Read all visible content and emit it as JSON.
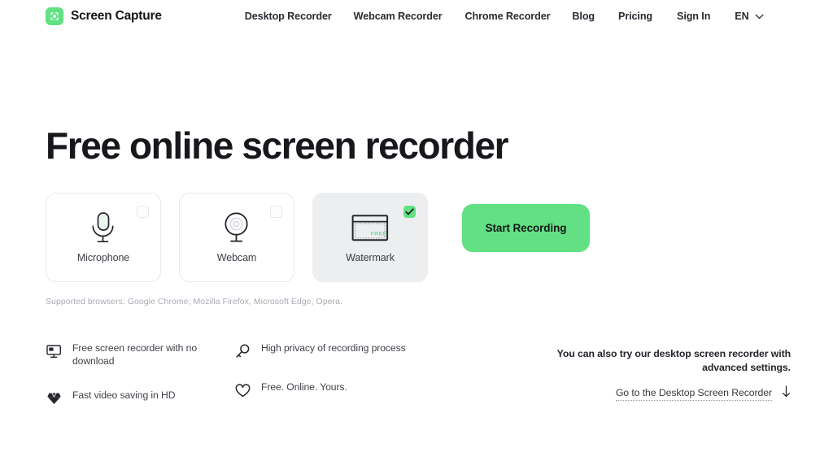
{
  "header": {
    "brand": {
      "name": "Screen Capture",
      "logo_icon": "record-focus-icon",
      "logo_color": "#62E083"
    },
    "nav": [
      {
        "label": "Desktop Recorder",
        "name": "nav-desktop-recorder"
      },
      {
        "label": "Webcam Recorder",
        "name": "nav-webcam-recorder"
      },
      {
        "label": "Chrome Recorder",
        "name": "nav-chrome-recorder"
      },
      {
        "label": "Blog",
        "name": "nav-blog"
      },
      {
        "label": "Pricing",
        "name": "nav-pricing"
      },
      {
        "label": "Sign In",
        "name": "nav-sign-in"
      }
    ],
    "language": {
      "label": "EN",
      "icon": "chevron-down-icon"
    }
  },
  "hero": {
    "title": "Free online screen recorder"
  },
  "options": [
    {
      "label": "Microphone",
      "icon": "microphone-icon",
      "checked": false,
      "selected": false
    },
    {
      "label": "Webcam",
      "icon": "webcam-icon",
      "checked": false,
      "selected": false
    },
    {
      "label": "Watermark",
      "icon": "watermark-window-icon",
      "icon_text": "FREE",
      "checked": true,
      "selected": true
    }
  ],
  "start_button": {
    "label": "Start Recording",
    "color": "#62E083"
  },
  "supported_browsers": "Supported browsers: Google Chrome, Mozilla Firefox, Microsoft Edge, Opera.",
  "features": {
    "column_1": [
      {
        "text": "Free screen recorder with no download",
        "icon": "monitor-icon"
      },
      {
        "text": "Fast video saving in HD",
        "icon": "diamond-icon"
      }
    ],
    "column_2": [
      {
        "text": "High privacy of recording process",
        "icon": "key-icon"
      },
      {
        "text": "Free. Online. Yours.",
        "icon": "heart-icon"
      }
    ]
  },
  "cta": {
    "text": "You can also try our desktop screen recorder with advanced settings.",
    "link_label": "Go to the Desktop Screen Recorder",
    "link_icon": "arrow-down-icon"
  }
}
